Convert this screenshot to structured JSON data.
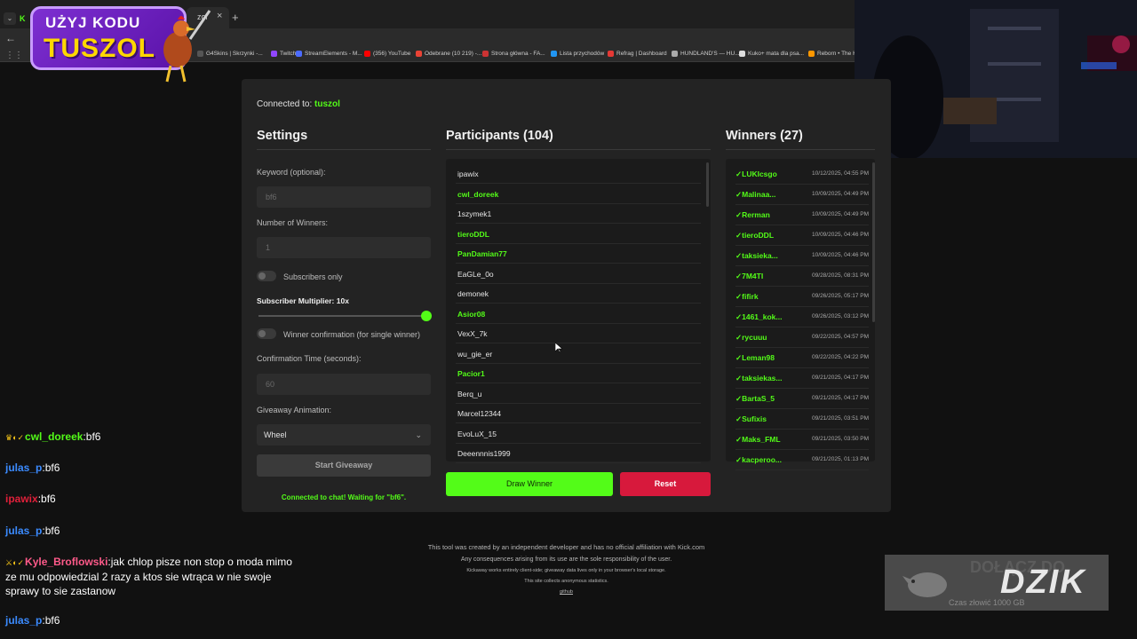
{
  "browser": {
    "tab_title": "zol",
    "tab_close": "×",
    "new_tab": "+",
    "tab_menu": "⌄",
    "tab_kick_logo": "K",
    "back": "←",
    "apps": "⋮⋮",
    "bookmarks": [
      {
        "label": "G4Skins | Skrzynki -...",
        "color": "#555"
      },
      {
        "label": "Twitch",
        "color": "#9146ff"
      },
      {
        "label": "StreamElements - M...",
        "color": "#4b6bff"
      },
      {
        "label": "(356) YouTube",
        "color": "#ff0000"
      },
      {
        "label": "Odebrane (10 219) -...",
        "color": "#ea4335"
      },
      {
        "label": "Strona główna - FA...",
        "color": "#cc3333"
      },
      {
        "label": "Lista przychodów",
        "color": "#2196f3"
      },
      {
        "label": "Refrag | Dashboard",
        "color": "#e53935"
      },
      {
        "label": "HUNDLAND'S — HU...",
        "color": "#aaa"
      },
      {
        "label": "Kuko+ mata dla psa...",
        "color": "#ddd"
      },
      {
        "label": "Reborn • The He...",
        "color": "#ff9800"
      }
    ]
  },
  "promo": {
    "line1": "UŻYJ KODU",
    "line2": "TUSZOL"
  },
  "app": {
    "connected_prefix": "Connected to: ",
    "connected_channel": "tuszol",
    "settings": {
      "title": "Settings",
      "keyword_label": "Keyword (optional):",
      "keyword_placeholder": "bf6",
      "winners_label": "Number of Winners:",
      "winners_placeholder": "1",
      "subscribers_only_label": "Subscribers only",
      "multiplier_label": "Subscriber Multiplier: 10x",
      "multiplier_value": 10,
      "confirmation_label": "Winner confirmation (for single winner)",
      "confirmation_time_label": "Confirmation Time (seconds):",
      "confirmation_time_placeholder": "60",
      "animation_label": "Giveaway Animation:",
      "animation_value": "Wheel",
      "animation_chevron": "⌄",
      "start_button": "Start Giveaway",
      "chat_status": "Connected to chat! Waiting for \"bf6\"."
    },
    "participants": {
      "title": "Participants (104)",
      "rows": [
        {
          "name": "ipawix",
          "sub": false
        },
        {
          "name": "cwl_doreek",
          "sub": true
        },
        {
          "name": "1szymek1",
          "sub": false
        },
        {
          "name": "tieroDDL",
          "sub": true
        },
        {
          "name": "PanDamian77",
          "sub": true
        },
        {
          "name": "EaGLe_0o",
          "sub": false
        },
        {
          "name": "demonek",
          "sub": false
        },
        {
          "name": "Asior08",
          "sub": true
        },
        {
          "name": "VexX_7k",
          "sub": false
        },
        {
          "name": "wu_gie_er",
          "sub": false
        },
        {
          "name": "Pacior1",
          "sub": true
        },
        {
          "name": "Berq_u",
          "sub": false
        },
        {
          "name": "Marcel12344",
          "sub": false
        },
        {
          "name": "EvoLuX_15",
          "sub": false
        },
        {
          "name": "Deeennnis1999",
          "sub": false
        }
      ],
      "draw_button": "Draw Winner",
      "reset_button": "Reset"
    },
    "winners": {
      "title": "Winners (27)",
      "rows": [
        {
          "name": "✓LUKIcsgo",
          "date": "10/12/2025, 04:55 PM"
        },
        {
          "name": "✓Malinaa...",
          "date": "10/09/2025, 04:49 PM"
        },
        {
          "name": "✓Rerman",
          "date": "10/09/2025, 04:49 PM"
        },
        {
          "name": "✓tieroDDL",
          "date": "10/09/2025, 04:46 PM"
        },
        {
          "name": "✓taksieka...",
          "date": "10/09/2025, 04:46 PM"
        },
        {
          "name": "✓7M4TI",
          "date": "09/28/2025, 08:31 PM"
        },
        {
          "name": "✓fifirk",
          "date": "09/26/2025, 05:17 PM"
        },
        {
          "name": "✓1461_kok...",
          "date": "09/26/2025, 03:12 PM"
        },
        {
          "name": "✓rycuuu",
          "date": "09/22/2025, 04:57 PM"
        },
        {
          "name": "✓Leman98",
          "date": "09/22/2025, 04:22 PM"
        },
        {
          "name": "✓taksiekas...",
          "date": "09/21/2025, 04:17 PM"
        },
        {
          "name": "✓BartaS_5",
          "date": "09/21/2025, 04:17 PM"
        },
        {
          "name": "✓Sufixis",
          "date": "09/21/2025, 03:51 PM"
        },
        {
          "name": "✓Maks_FML",
          "date": "09/21/2025, 03:50 PM"
        },
        {
          "name": "✓kacperoo...",
          "date": "09/21/2025, 01:13 PM"
        }
      ]
    }
  },
  "footer": {
    "line1": "This tool was created by an independent developer and has no official affiliation with Kick.com",
    "line2": "Any consequences arising from its use are the sole responsibility of the user.",
    "line3": "Kickaway works entirely client-side; giveaway data lives only in your browser's local storage.",
    "line4": "This site collects anonymous statistics.",
    "link": "github"
  },
  "chat": [
    {
      "badges": "♛◐✓",
      "user": "cwl_doreek",
      "color": "#53fc18",
      "text": "bf6"
    },
    {
      "badges": "",
      "user": "julas_p",
      "color": "#3b8bff",
      "text": "bf6"
    },
    {
      "badges": "",
      "user": "ipawix",
      "color": "#e0203a",
      "text": "bf6"
    },
    {
      "badges": "",
      "user": "julas_p",
      "color": "#3b8bff",
      "text": "bf6"
    },
    {
      "badges": "⚔◐✓",
      "user": "Kyle_Broflowski",
      "color": "#ff5a8a",
      "text": "jak chlop pisze non stop o moda mimo ze mu odpowiedzial 2 razy a ktos sie wtrąca w nie swoje sprawy to sie zastanow"
    },
    {
      "badges": "",
      "user": "julas_p",
      "color": "#3b8bff",
      "text": "bf6"
    }
  ],
  "sponsor": {
    "bg_text": "DOŁĄCZ DO",
    "main": "DZIK",
    "sub": "Czas złowić 1000 GB"
  }
}
